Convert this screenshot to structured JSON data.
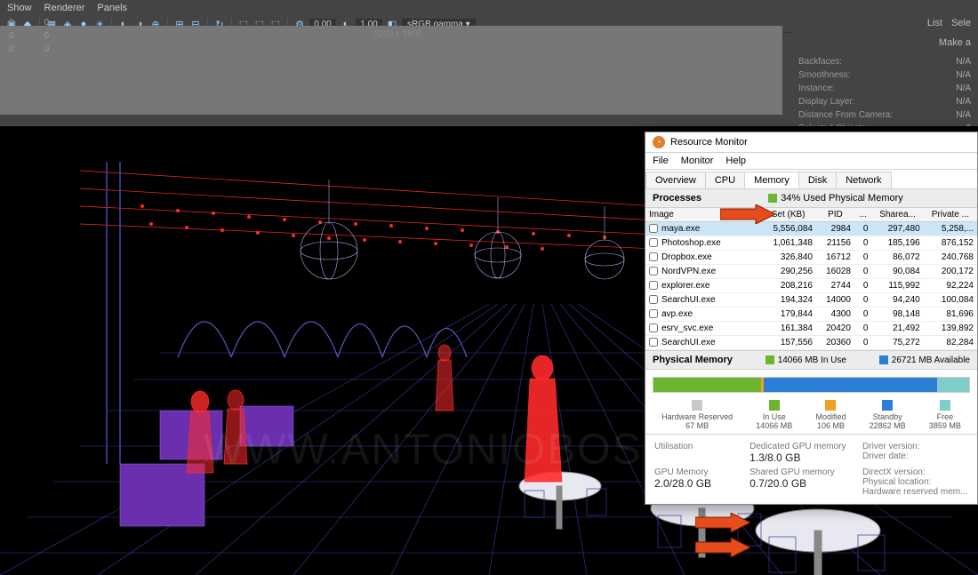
{
  "maya": {
    "menubar": [
      "Show",
      "Renderer",
      "Panels"
    ],
    "resolution": "3200 x 1800",
    "num1": "0.00",
    "num2": "1.00",
    "colorspace": "sRGB gamma",
    "right_tabs": [
      "List",
      "Sele"
    ],
    "make_link": "Make a",
    "zeros": [
      [
        "0",
        "0"
      ],
      [
        "0",
        "0"
      ],
      [
        "0",
        "0"
      ]
    ],
    "stats": [
      {
        "k": "Backfaces:",
        "v": "N/A"
      },
      {
        "k": "Smoothness:",
        "v": "N/A"
      },
      {
        "k": "Instance:",
        "v": "N/A"
      },
      {
        "k": "Display Layer:",
        "v": "N/A"
      },
      {
        "k": "Distance From Camera:",
        "v": "N/A"
      },
      {
        "k": "Selected Objects:",
        "v": "0"
      }
    ]
  },
  "watermark": "WWW.ANTONIOBOSI.COM",
  "resmon": {
    "title": "Resource Monitor",
    "menu": [
      "File",
      "Monitor",
      "Help"
    ],
    "tabs": [
      "Overview",
      "CPU",
      "Memory",
      "Disk",
      "Network"
    ],
    "active_tab": "Memory",
    "processes_hdr": "Processes",
    "used_phys": "34% Used Physical Memory",
    "columns": [
      "Image",
      "Working Set (KB)",
      "PID",
      "...",
      "Sharea...",
      "Private ..."
    ],
    "rows": [
      {
        "img": "maya.exe",
        "ws": "5,556,084",
        "pid": "2984",
        "h": "0",
        "sh": "297,480",
        "pv": "5,258,...",
        "sel": true
      },
      {
        "img": "Photoshop.exe",
        "ws": "1,061,348",
        "pid": "21156",
        "h": "0",
        "sh": "185,196",
        "pv": "876,152"
      },
      {
        "img": "Dropbox.exe",
        "ws": "326,840",
        "pid": "16712",
        "h": "0",
        "sh": "86,072",
        "pv": "240,768"
      },
      {
        "img": "NordVPN.exe",
        "ws": "290,256",
        "pid": "16028",
        "h": "0",
        "sh": "90,084",
        "pv": "200,172"
      },
      {
        "img": "explorer.exe",
        "ws": "208,216",
        "pid": "2744",
        "h": "0",
        "sh": "115,992",
        "pv": "92,224"
      },
      {
        "img": "SearchUI.exe",
        "ws": "194,324",
        "pid": "14000",
        "h": "0",
        "sh": "94,240",
        "pv": "100,084"
      },
      {
        "img": "avp.exe",
        "ws": "179,844",
        "pid": "4300",
        "h": "0",
        "sh": "98,148",
        "pv": "81,696"
      },
      {
        "img": "esrv_svc.exe",
        "ws": "161,384",
        "pid": "20420",
        "h": "0",
        "sh": "21,492",
        "pv": "139,892"
      },
      {
        "img": "SearchUI.exe",
        "ws": "157,556",
        "pid": "20360",
        "h": "0",
        "sh": "75,272",
        "pv": "82,284"
      }
    ],
    "physmem_hdr": "Physical Memory",
    "physmem_inuse": "14066 MB In Use",
    "physmem_avail": "26721 MB Available",
    "legend": [
      {
        "color": "#c8c8c8",
        "lab": "Hardware Reserved",
        "val": "67 MB"
      },
      {
        "color": "#6eb52f",
        "lab": "In Use",
        "val": "14066 MB"
      },
      {
        "color": "#f0a020",
        "lab": "Modified",
        "val": "106 MB"
      },
      {
        "color": "#2a7fd4",
        "lab": "Standby",
        "val": "22862 MB"
      },
      {
        "color": "#7fccc8",
        "lab": "Free",
        "val": "3859 MB"
      }
    ],
    "gpu": {
      "util_lbl": "Utilisation",
      "ded_lbl": "Dedicated GPU memory",
      "ded_val": "1.3/8.0 GB",
      "gpumem_lbl": "GPU Memory",
      "gpumem_val": "2.0/28.0 GB",
      "shared_lbl": "Shared GPU memory",
      "shared_val": "0.7/20.0 GB",
      "driver_ver": "Driver version:",
      "driver_date": "Driver date:",
      "dx": "DirectX version:",
      "loc": "Physical location:",
      "hw_res": "Hardware reserved mem..."
    }
  }
}
